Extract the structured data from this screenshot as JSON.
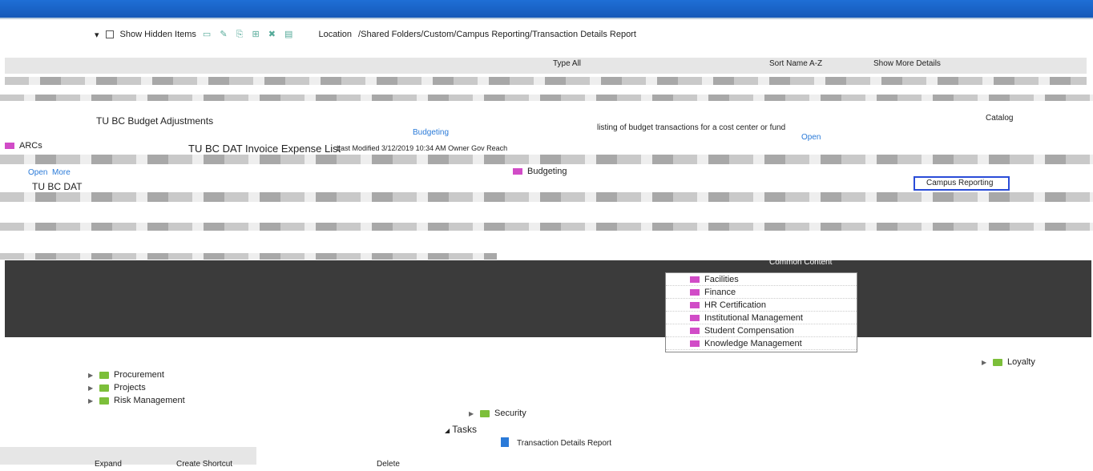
{
  "titlebar": {
    "title": ""
  },
  "toolbar": {
    "show_hidden_items": "Show Hidden Items",
    "location_label": "Location",
    "path": "/Shared Folders/Custom/Campus Reporting/Transaction Details Report"
  },
  "header_row": {
    "sort_label": "Sort Name A-Z",
    "show_more": "Show More Details",
    "type_label": "Type All"
  },
  "reports": [
    {
      "name": "TU BC Budget Adjustments",
      "desc": ""
    },
    {
      "name": "TU BC DAT Invoice Expense List",
      "desc": "Last Modified 3/12/2019 10:34 AM  Owner Gov Reach"
    },
    {
      "name": "TU BC DAT",
      "desc": ""
    }
  ],
  "left_folder": "ARCs",
  "links": {
    "open": "Open",
    "edit": "Edit",
    "more": "More"
  },
  "budgeting": "Budgeting",
  "listing_text": "listing of budget transactions for a cost center or fund",
  "catalog_label": "Catalog",
  "right_panel": [
    "Campus Reporting",
    "Loyalty"
  ],
  "dropdown": {
    "title": "Common Content",
    "items": [
      "Facilities",
      "Finance",
      "HR Certification",
      "Institutional Management",
      "Student Compensation",
      "Knowledge Management"
    ]
  },
  "lower_tree": [
    {
      "label": "Procurement"
    },
    {
      "label": "Projects"
    },
    {
      "label": "Risk Management"
    }
  ],
  "security": "Security",
  "tasks": {
    "title": "Tasks",
    "item": "Transaction Details Report"
  },
  "bottom": {
    "expand": "Expand",
    "create_shortcut": "Create Shortcut",
    "delete": "Delete"
  }
}
